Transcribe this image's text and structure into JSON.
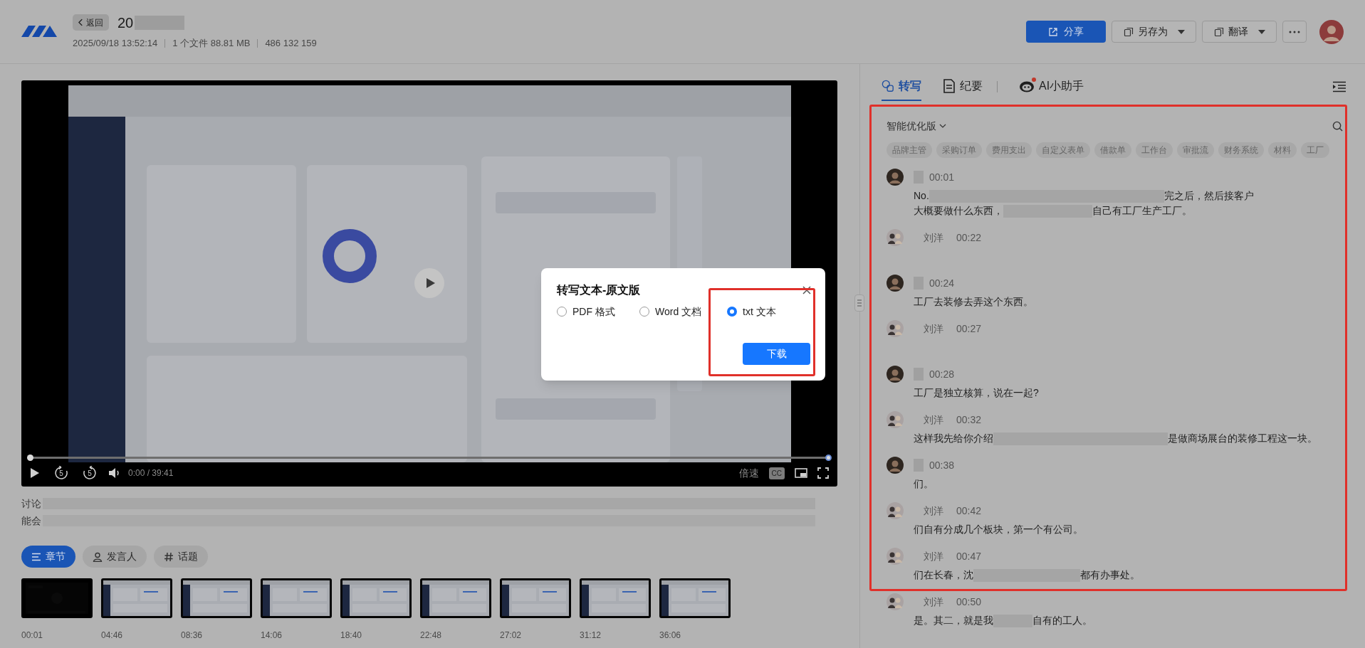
{
  "header": {
    "back": "返回",
    "title": "20",
    "date": "2025/09/18 13:52:14",
    "files": "1 个文件 88.81 MB",
    "size": "486 132 159",
    "share": "分享",
    "save_as": "另存为",
    "translate": "翻译"
  },
  "player": {
    "time": "0:00 / 39:41",
    "speed": "倍速",
    "cc": "CC",
    "skip_back": "5",
    "skip_forward": "5",
    "level": 0
  },
  "summary": [
    "讨论",
    "能会"
  ],
  "view_tabs": [
    {
      "label": "章节",
      "selected": true
    },
    {
      "label": "发言人",
      "selected": false
    },
    {
      "label": "话题",
      "selected": false
    }
  ],
  "chapters": [
    {
      "time": "00:01"
    },
    {
      "time": "04:46"
    },
    {
      "time": "08:36"
    },
    {
      "time": "14:06"
    },
    {
      "time": "18:40"
    },
    {
      "time": "22:48"
    },
    {
      "time": "27:02"
    },
    {
      "time": "31:12"
    },
    {
      "time": "36:06"
    }
  ],
  "panel": {
    "tabs": [
      {
        "label": "转写",
        "selected": true,
        "dot": false
      },
      {
        "label": "纪要",
        "selected": false,
        "dot": false
      },
      {
        "label": "AI小助手",
        "selected": false,
        "dot": true
      }
    ],
    "version": "智能优化版",
    "keywords": [
      "品牌主管",
      "采购订单",
      "费用支出",
      "自定义表单",
      "借款单",
      "工作台",
      "审批流",
      "财务系统",
      "材料",
      "工厂"
    ],
    "entries": [
      {
        "kind": "single",
        "time": "00:01",
        "lines": [
          [
            "No.",
            "完之后，然后接客户"
          ],
          [
            "大概要做什么东西，",
            "自己有工厂生产工厂。"
          ]
        ]
      },
      {
        "kind": "pair",
        "name": "刘洋",
        "time": "00:22"
      },
      {
        "kind": "single",
        "time": "00:24",
        "lines": [
          [
            "工厂去装修去弄这个东西。"
          ]
        ]
      },
      {
        "kind": "pair",
        "name": "刘洋",
        "time": "00:27"
      },
      {
        "kind": "single",
        "time": "00:28",
        "lines": [
          [
            "工厂是独立核算，说在一起?"
          ]
        ]
      },
      {
        "kind": "pair",
        "name": "刘洋",
        "time": "00:32",
        "lines": [
          [
            "这样我先给你介绍",
            "是做商场展台的装修工程这一块。"
          ]
        ]
      },
      {
        "kind": "single",
        "time": "00:38",
        "lines": [
          [
            "们。"
          ]
        ]
      },
      {
        "kind": "pair",
        "name": "刘洋",
        "time": "00:42",
        "lines": [
          [
            "们自有分成几个板块，第一个有公司。"
          ]
        ]
      },
      {
        "kind": "pair",
        "name": "刘洋",
        "time": "00:47",
        "lines": [
          [
            "们在长春，沈",
            "都有办事处。"
          ]
        ]
      },
      {
        "kind": "pair",
        "name": "刘洋",
        "time": "00:50",
        "lines": [
          [
            "是。其二，就是我",
            "自有的工人。"
          ]
        ]
      }
    ]
  },
  "dialog": {
    "title": "转写文本-原文版",
    "options": [
      {
        "label": "PDF 格式",
        "selected": false
      },
      {
        "label": "Word 文档",
        "selected": false
      },
      {
        "label": "txt 文本",
        "selected": true
      }
    ],
    "button": "下载"
  }
}
